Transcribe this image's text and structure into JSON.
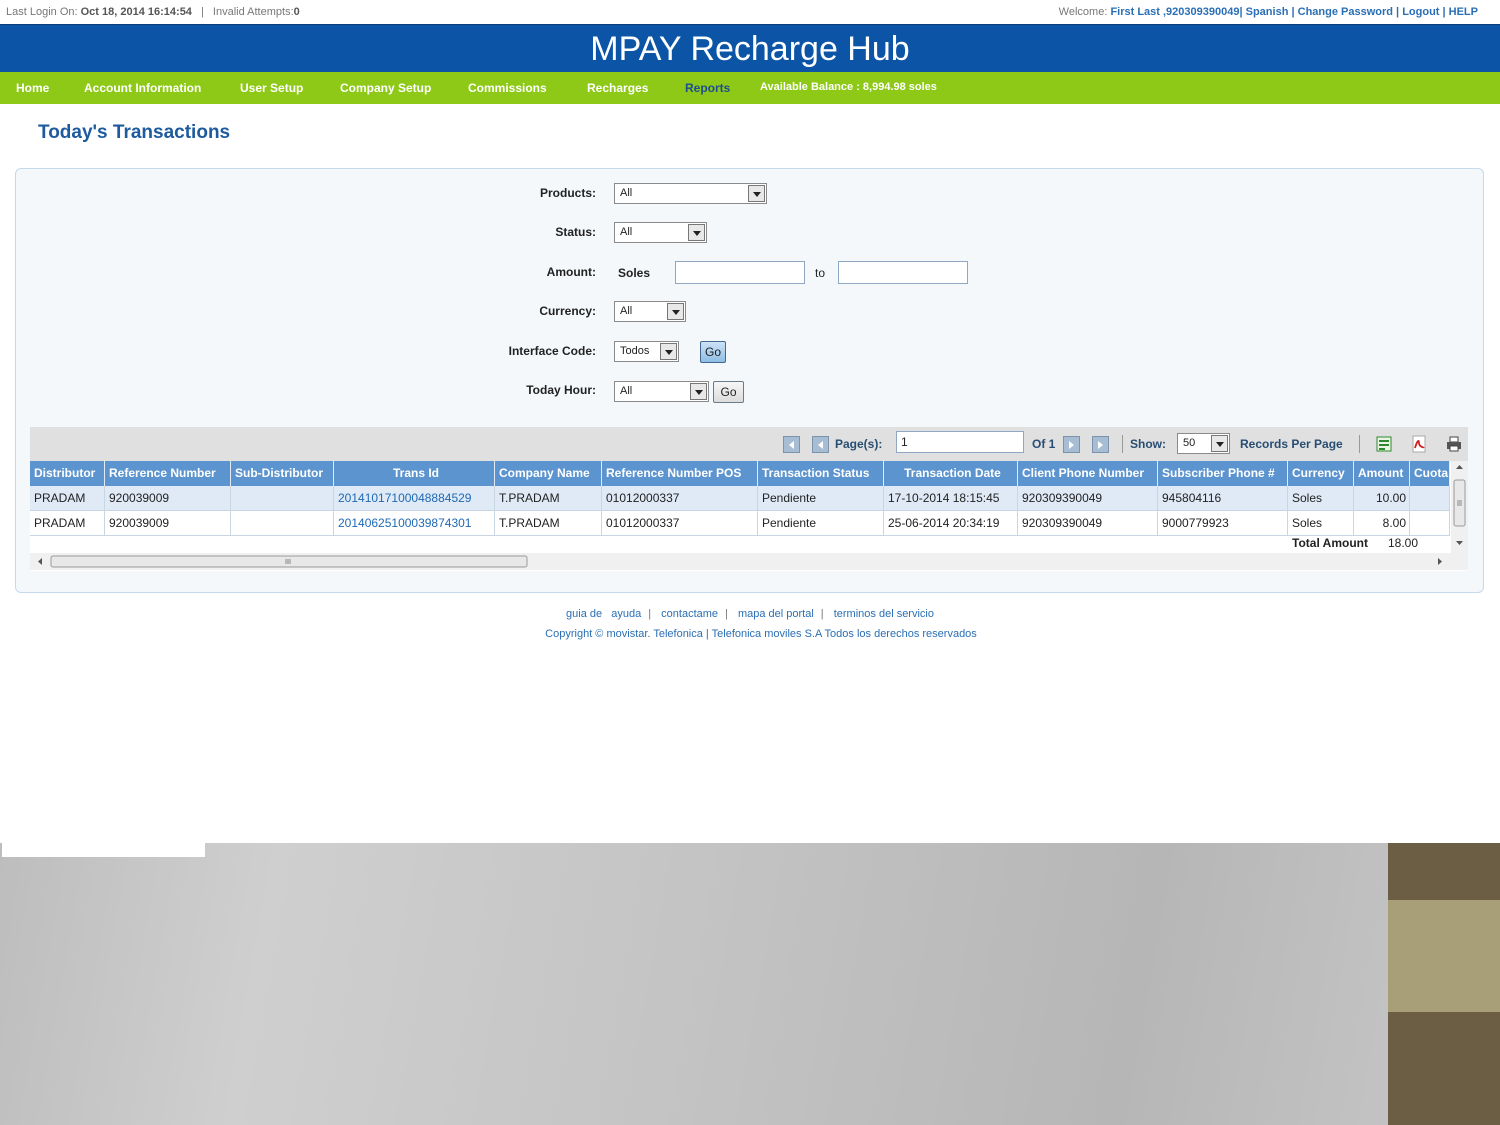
{
  "topbar": {
    "last_login_label": "Last Login On:",
    "last_login_value": "Oct 18, 2014 16:14:54",
    "separator": "|",
    "invalid_label": "Invalid Attempts:",
    "invalid_value": "0",
    "welcome_label": "Welcome:",
    "welcome_user": "First Last ,920309390049",
    "links": [
      "Spanish",
      "Change Password",
      "Logout",
      "HELP"
    ]
  },
  "header": {
    "title": "MPAY Recharge Hub"
  },
  "nav": {
    "items": [
      "Home",
      "Account Information",
      "User Setup",
      "Company Setup",
      "Commissions",
      "Recharges",
      "Reports"
    ],
    "active": "Reports",
    "balance": "Available Balance : 8,994.98 soles"
  },
  "page": {
    "title": "Today's Transactions"
  },
  "filters": {
    "products_label": "Products:",
    "products_value": "All",
    "status_label": "Status:",
    "status_value": "All",
    "amount_label": "Amount:",
    "amount_currency": "Soles",
    "amount_to": "to",
    "currency_label": "Currency:",
    "currency_value": "All",
    "interface_label": "Interface Code:",
    "interface_value": "Todos",
    "interface_go": "Go",
    "hour_label": "Today Hour:",
    "hour_value": "All",
    "hour_go": "Go"
  },
  "pager": {
    "pages_label": "Page(s):",
    "page_value": "1",
    "of_label": "Of 1",
    "show_label": "Show:",
    "show_value": "50",
    "records_label": "Records Per Page"
  },
  "table": {
    "columns": [
      "Distributor",
      "Reference Number",
      "Sub-Distributor",
      "Trans Id",
      "Company Name",
      "Reference Number POS",
      "Transaction Status",
      "Transaction Date",
      "Client Phone Number",
      "Subscriber Phone #",
      "Currency",
      "Amount",
      "Cuota"
    ],
    "rows": [
      [
        "PRADAM",
        "920039009",
        "",
        "20141017100048884529",
        "T.PRADAM",
        "01012000337",
        "Pendiente",
        "17-10-2014 18:15:45",
        "920309390049",
        "945804116",
        "Soles",
        "10.00",
        ""
      ],
      [
        "PRADAM",
        "920039009",
        "",
        "20140625100039874301",
        "T.PRADAM",
        "01012000337",
        "Pendiente",
        "25-06-2014 20:34:19",
        "920309390049",
        "9000779923",
        "Soles",
        "8.00",
        ""
      ]
    ],
    "total_label": "Total Amount",
    "total_value": "18.00"
  },
  "footer": {
    "links": [
      "guia de   ayuda",
      "contactame",
      "mapa del portal",
      "terminos del servicio"
    ],
    "copyright": "Copyright © movistar. Telefonica | Telefonica moviles S.A Todos los derechos reservados"
  }
}
